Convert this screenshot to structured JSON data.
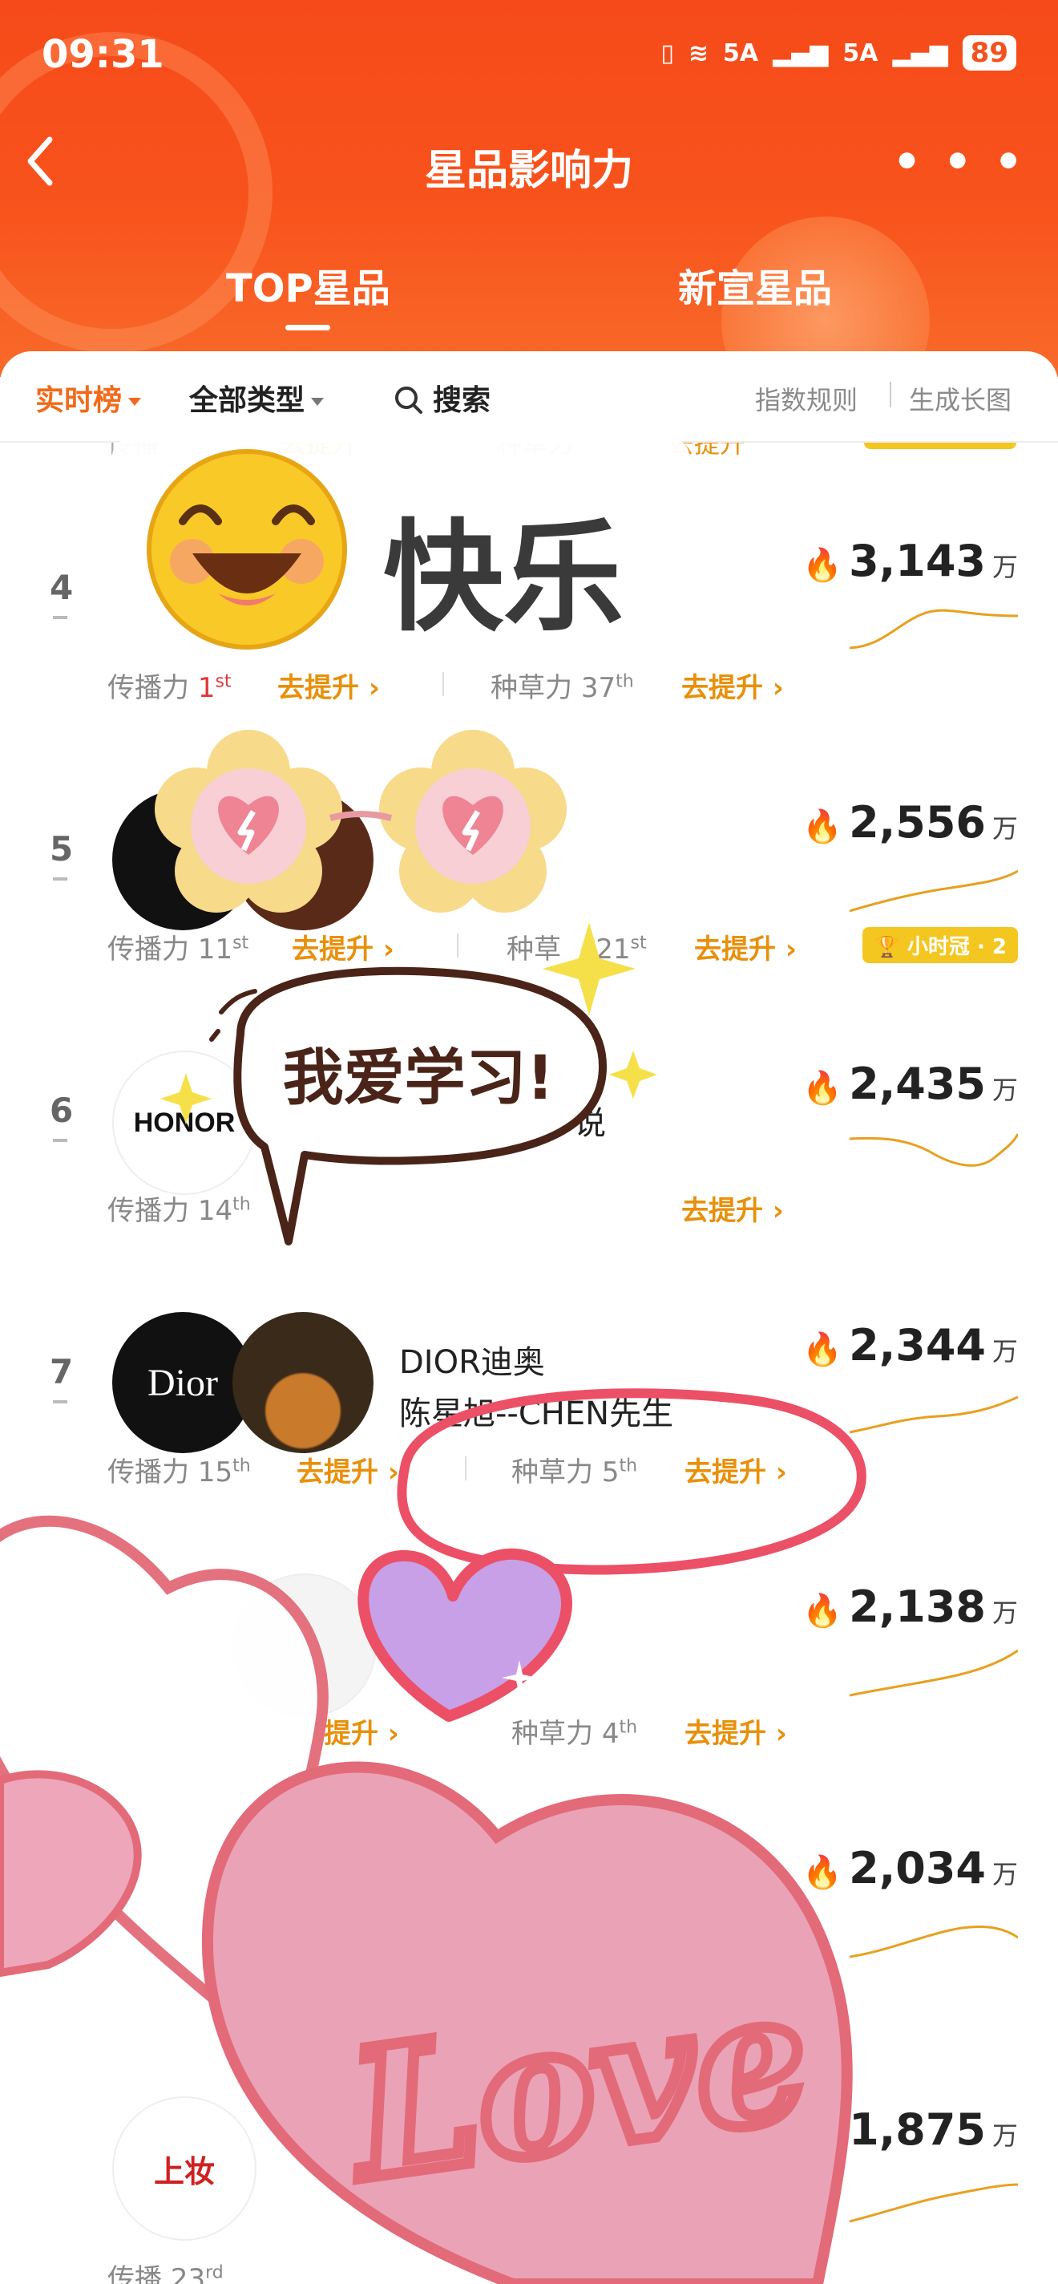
{
  "status_bar": {
    "time": "09:31",
    "signal_1": "5A",
    "signal_2": "5A",
    "battery": "89"
  },
  "nav": {
    "back_icon": "chevron-left-icon",
    "title": "星品影响力",
    "more_icon": "ellipsis-icon"
  },
  "tabs": [
    {
      "label": "TOP星品",
      "active": true
    },
    {
      "label": "新宣星品",
      "active": false
    }
  ],
  "filters": {
    "realtime": "实时榜",
    "all_types": "全部类型",
    "search": "搜索",
    "index_rules": "指数规则",
    "generate_image": "生成长图"
  },
  "colors": {
    "accent": "#F64A1A",
    "go_link": "#E8900B",
    "score_flame": "#F25D1E",
    "sparkline": "#E8A020"
  },
  "rows": [
    {
      "rank": "4",
      "score": "3,143",
      "unit": "万",
      "spread_label": "传播力",
      "spread_rank": "1",
      "spread_suffix": "st",
      "spread_go": "去提升",
      "grass_label": "种草力",
      "grass_rank": "37",
      "grass_suffix": "th",
      "grass_go": "去提升"
    },
    {
      "rank": "5",
      "score": "2,556",
      "unit": "万",
      "spread_label": "传播力",
      "spread_rank": "11",
      "spread_suffix": "st",
      "spread_go": "去提升",
      "grass_label": "种草",
      "grass_rank": "21",
      "grass_suffix": "st",
      "grass_go": "去提升",
      "badge": "小时冠 · 2"
    },
    {
      "rank": "6",
      "score": "2,435",
      "unit": "万",
      "logo_text": "HONOR",
      "name_fragment": "说",
      "spread_label": "传播力",
      "spread_rank": "14",
      "spread_suffix": "th",
      "spread_go": "去提升",
      "grass_go": "去提升"
    },
    {
      "rank": "7",
      "score": "2,344",
      "unit": "万",
      "logo_text": "Dior",
      "name_line_1": "DIOR迪奥",
      "name_line_2": "陈星旭--CHEN先生",
      "spread_label": "传播力",
      "spread_rank": "15",
      "spread_suffix": "th",
      "spread_go": "去提升",
      "grass_label": "种草力",
      "grass_rank": "5",
      "grass_suffix": "th",
      "grass_go": "去提升"
    },
    {
      "score": "2,138",
      "unit": "万",
      "spread_go": "提升",
      "grass_label": "种草力",
      "grass_rank": "4",
      "grass_suffix": "th",
      "grass_go": "去提升"
    },
    {
      "score": "2,034",
      "unit": "万"
    },
    {
      "score": "1,875",
      "unit": "万",
      "logo_text": "上妆",
      "spread_label": "传播",
      "spread_rank": "23",
      "spread_suffix": "rd"
    }
  ],
  "stickers": {
    "happy": "快乐",
    "study": "我爱学习!",
    "love": "Love"
  }
}
